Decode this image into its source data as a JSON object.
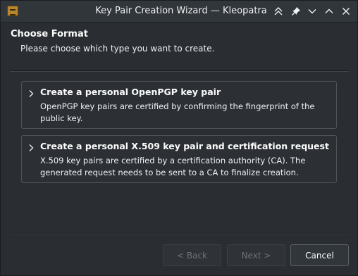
{
  "window": {
    "title": "Key Pair Creation Wizard — Kleopatra",
    "app_icon": "kleopatra-icon",
    "controls": [
      "keep-above-icon",
      "pin-icon",
      "minimize-icon",
      "maximize-icon",
      "close-icon"
    ]
  },
  "header": {
    "title": "Choose Format",
    "subtitle": "Please choose which type you want to create."
  },
  "options": [
    {
      "title": "Create a personal OpenPGP key pair",
      "description": "OpenPGP key pairs are certified by confirming the fingerprint of the public key."
    },
    {
      "title": "Create a personal X.509 key pair and certification request",
      "description": "X.509 key pairs are certified by a certification authority (CA). The generated request needs to be sent to a CA to finalize creation."
    }
  ],
  "buttons": {
    "back": "< Back",
    "next": "Next >",
    "cancel": "Cancel"
  }
}
